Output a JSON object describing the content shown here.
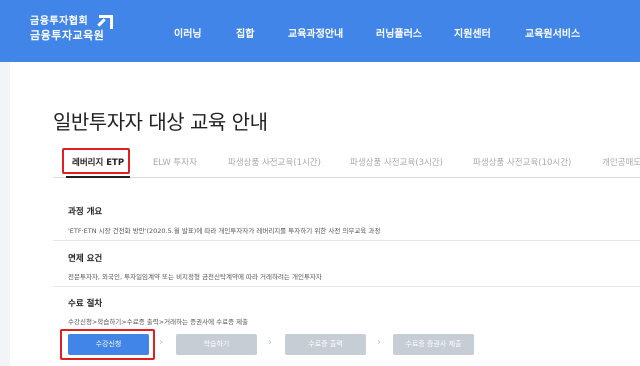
{
  "header": {
    "logo_line1": "금융투자협회",
    "logo_line2": "금융투자교육원",
    "nav": [
      "이러닝",
      "집합",
      "교육과정안내",
      "러닝플러스",
      "지원센터",
      "교육원서비스"
    ]
  },
  "page_title": "일반투자자 대상 교육 안내",
  "tabs": [
    "레버리지 ETP",
    "ELW 투자자",
    "파생상품 사전교육(1시간)",
    "파생상품 사전교육(3시간)",
    "파생상품 사전교육(10시간)",
    "개인공매도"
  ],
  "sections": {
    "overview_title": "과정 개요",
    "overview_text": "'ETF·ETN 시장 건전화 방안'(2020.5.월 발표)에 따라 개인투자자가 레버리지를 투자하기 위한 사전 의무교육 과정",
    "exemption_title": "면제 요건",
    "exemption_text": "전문투자자, 외국인, 투자일임계약 또는 비지정형 금전신탁계약에 따라 거래하려는 개인투자자",
    "procedure_title": "수료 절차",
    "procedure_text": "수강신청>학습하기>수료증 출력>거래하는 증권사에 수료증 제출"
  },
  "steps": [
    "수강신청",
    "학습하기",
    "수료증 출력",
    "수료증 증권사 제출"
  ],
  "colors": {
    "header_bg": "#4285e8",
    "highlight": "#e02020",
    "disabled": "#c7cdd4"
  }
}
